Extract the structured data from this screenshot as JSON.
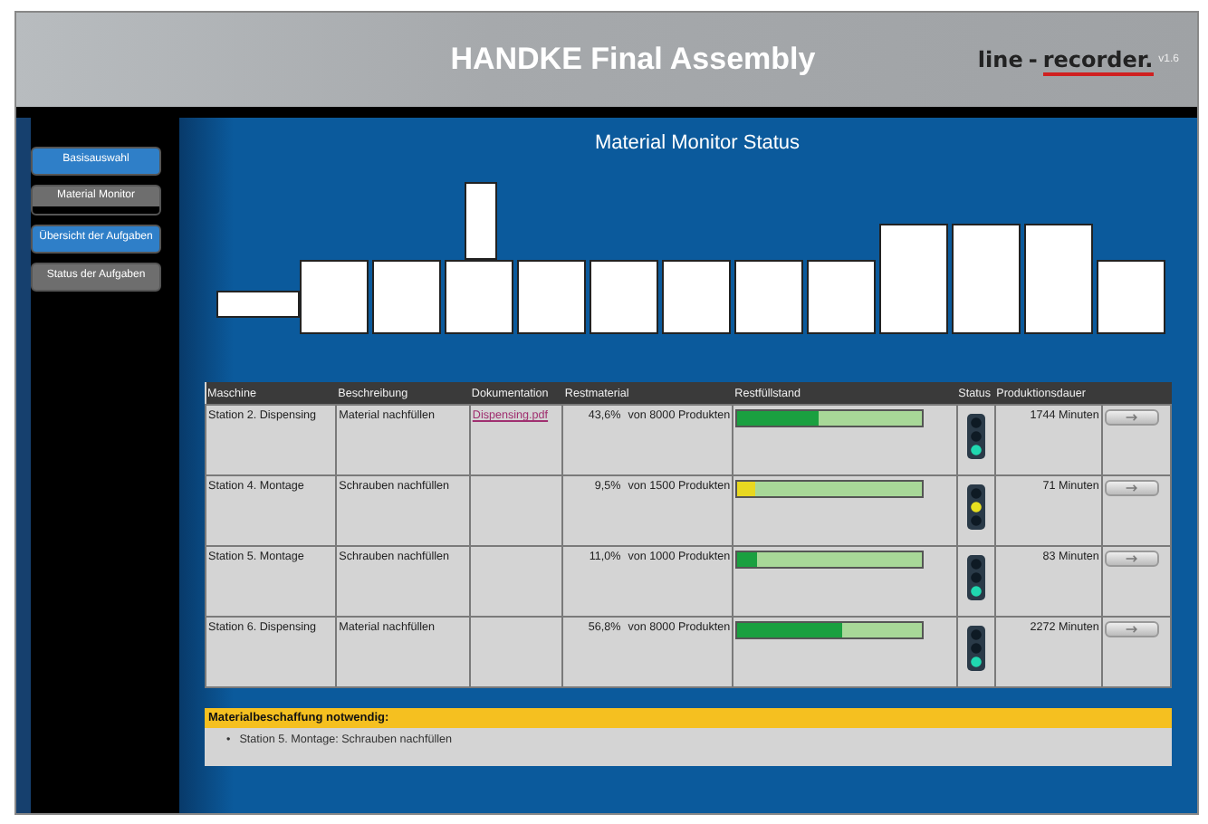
{
  "header": {
    "title": "HANDKE Final Assembly",
    "logo": {
      "name_left": "line",
      "separator": "-",
      "name_right": "recorder.",
      "version": "v1.6"
    }
  },
  "sidebar": {
    "items": [
      {
        "label": "Basisauswahl",
        "selected": false,
        "color": "#2f7fc8"
      },
      {
        "label": "Material Monitor",
        "selected": true,
        "color": "#6e6e6e"
      },
      {
        "label": "Übersicht der Aufgaben",
        "selected": false,
        "color": "#2f7fc8"
      },
      {
        "label": "Status der Aufgaben",
        "selected": false,
        "color": "#6e6e6e"
      }
    ]
  },
  "main": {
    "title": "Material Monitor Status",
    "table": {
      "columns": [
        "Maschine",
        "Beschreibung",
        "Dokumentation",
        "Restmaterial",
        "Restfüllstand",
        "Status",
        "Produktionsdauer"
      ],
      "rows": [
        {
          "machine": "Station 2. Dispensing",
          "description": "Material nachfüllen",
          "document": "Dispensing.pdf",
          "percent": "43,6%",
          "amount": "von 8000 Produkten",
          "level": 0.436,
          "color": "#1aa040",
          "warning": false,
          "duration": "1744 Minuten"
        },
        {
          "machine": "Station 4. Montage",
          "description": "Schrauben nachfüllen",
          "percent": "9,5%",
          "amount": "von 1500 Produkten",
          "level": 0.095,
          "color": "#e8d820",
          "warning": true,
          "duration": "71 Minuten"
        },
        {
          "machine": "Station 5. Montage",
          "description": "Schrauben nachfüllen",
          "percent": "11,0%",
          "amount": "von 1000 Produkten",
          "level": 0.11,
          "color": "#1aa040",
          "warning": false,
          "duration": "83 Minuten"
        },
        {
          "machine": "Station 6. Dispensing",
          "description": "Material nachfüllen",
          "percent": "56,8%",
          "amount": "von 8000 Produkten",
          "level": 0.568,
          "color": "#1aa040",
          "warning": false,
          "duration": "2272 Minuten"
        }
      ]
    },
    "alert": {
      "title": "Materialbeschaffung notwendig:",
      "items": [
        {
          "marker": "•",
          "text": "Station 5. Montage: Schrauben nachfüllen"
        }
      ]
    }
  }
}
